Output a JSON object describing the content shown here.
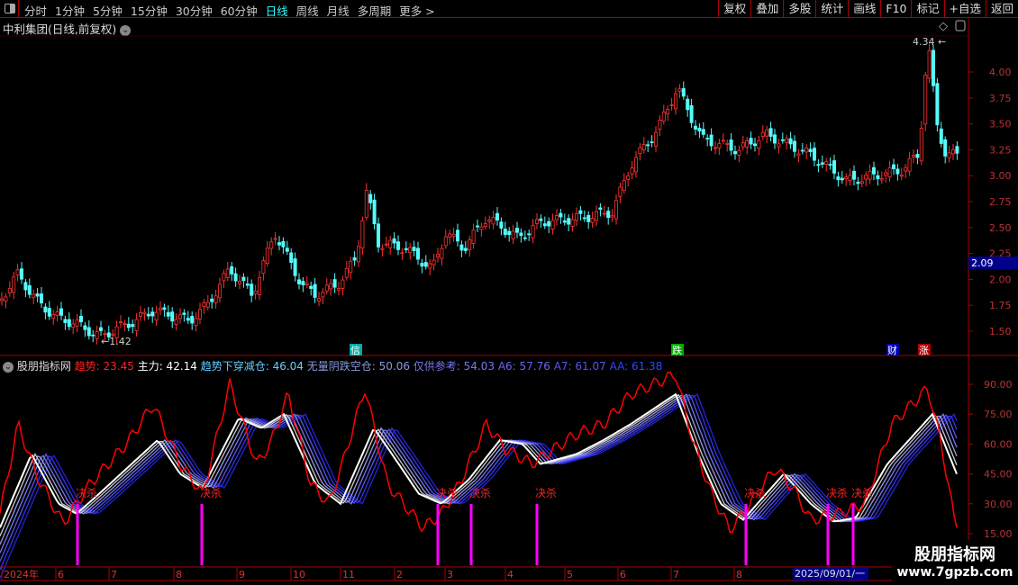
{
  "toolbar": {
    "periods": [
      "分时",
      "1分钟",
      "5分钟",
      "15分钟",
      "30分钟",
      "60分钟",
      "日线",
      "周线",
      "月线",
      "多周期",
      "更多 >"
    ],
    "active": "日线",
    "buttons": [
      "复权",
      "叠加",
      "多股",
      "统计",
      "画线",
      "F10",
      "标记",
      "+自选",
      "返回"
    ]
  },
  "title": "中利集团(日线,前复权)",
  "price_axis": [
    "4.00",
    "3.75",
    "3.50",
    "3.25",
    "3.00",
    "2.75",
    "2.50",
    "2.25",
    "2.00",
    "1.75",
    "1.50"
  ],
  "current_price": "2.09",
  "high_label": "4.34",
  "low_label": "1.42",
  "event_tags": {
    "t1": "信",
    "t2": "跌",
    "t3": "财",
    "t4": "涨"
  },
  "indicator": {
    "name": "股朋指标网",
    "items": [
      {
        "label": "趋势: 23.45",
        "color": "#ff2020"
      },
      {
        "label": "主力: 42.14",
        "color": "#ffffff"
      },
      {
        "label": "趋势下穿减仓: 46.04",
        "color": "#66ccff"
      },
      {
        "label": "无量阴跌空仓: 50.06",
        "color": "#8899dd"
      },
      {
        "label": "仅供参考: 54.03",
        "color": "#7777ee"
      },
      {
        "label": "A6: 57.76",
        "color": "#6666ee"
      },
      {
        "label": "A7: 61.07",
        "color": "#5555ee"
      },
      {
        "label": "AA: 61.38",
        "color": "#3344ff"
      }
    ],
    "axis": [
      "90.00",
      "75.00",
      "60.00",
      "45.00",
      "30.00",
      "15.00"
    ],
    "signal": "决杀"
  },
  "time_axis": [
    [
      "2024年",
      2
    ],
    [
      "6",
      62
    ],
    [
      "7",
      121
    ],
    [
      "8",
      193
    ],
    [
      "9",
      263
    ],
    [
      "10",
      323
    ],
    [
      "11",
      378
    ],
    [
      "2",
      438
    ],
    [
      "3",
      494
    ],
    [
      "4",
      561
    ],
    [
      "5",
      627
    ],
    [
      "6",
      686
    ],
    [
      "7",
      745
    ],
    [
      "8",
      815
    ]
  ],
  "selected_date": "2025/09/01/一",
  "watermark": {
    "line1": "股朋指标网",
    "line2": "www.7gpzb.com"
  },
  "price_path": [
    [
      0,
      1.8
    ],
    [
      20,
      2.05
    ],
    [
      40,
      1.8
    ],
    [
      60,
      1.65
    ],
    [
      90,
      1.55
    ],
    [
      110,
      1.45
    ],
    [
      150,
      1.6
    ],
    [
      170,
      1.7
    ],
    [
      210,
      1.6
    ],
    [
      230,
      1.75
    ],
    [
      255,
      2.1
    ],
    [
      280,
      1.85
    ],
    [
      305,
      2.45
    ],
    [
      320,
      2.2
    ],
    [
      335,
      1.95
    ],
    [
      350,
      1.85
    ],
    [
      375,
      1.95
    ],
    [
      395,
      2.2
    ],
    [
      407,
      2.85
    ],
    [
      420,
      2.35
    ],
    [
      450,
      2.3
    ],
    [
      480,
      2.1
    ],
    [
      495,
      2.45
    ],
    [
      515,
      2.3
    ],
    [
      540,
      2.6
    ],
    [
      575,
      2.4
    ],
    [
      600,
      2.55
    ],
    [
      650,
      2.6
    ],
    [
      680,
      2.65
    ],
    [
      700,
      3.1
    ],
    [
      730,
      3.45
    ],
    [
      752,
      3.85
    ],
    [
      765,
      3.6
    ],
    [
      780,
      3.35
    ],
    [
      820,
      3.25
    ],
    [
      850,
      3.4
    ],
    [
      900,
      3.2
    ],
    [
      940,
      2.95
    ],
    [
      970,
      3.0
    ],
    [
      1000,
      3.05
    ],
    [
      1020,
      3.2
    ],
    [
      1030,
      4.3
    ],
    [
      1040,
      3.5
    ],
    [
      1050,
      3.2
    ],
    [
      1062,
      3.2
    ]
  ],
  "trend_path": [
    [
      0,
      25
    ],
    [
      20,
      70
    ],
    [
      40,
      45
    ],
    [
      70,
      20
    ],
    [
      100,
      40
    ],
    [
      140,
      60
    ],
    [
      170,
      80
    ],
    [
      200,
      50
    ],
    [
      225,
      35
    ],
    [
      255,
      90
    ],
    [
      285,
      50
    ],
    [
      300,
      60
    ],
    [
      320,
      85
    ],
    [
      345,
      40
    ],
    [
      365,
      30
    ],
    [
      380,
      50
    ],
    [
      405,
      88
    ],
    [
      430,
      40
    ],
    [
      470,
      18
    ],
    [
      490,
      25
    ],
    [
      510,
      40
    ],
    [
      540,
      70
    ],
    [
      560,
      58
    ],
    [
      590,
      50
    ],
    [
      640,
      65
    ],
    [
      670,
      70
    ],
    [
      700,
      85
    ],
    [
      750,
      95
    ],
    [
      770,
      60
    ],
    [
      790,
      35
    ],
    [
      810,
      17
    ],
    [
      830,
      28
    ],
    [
      860,
      48
    ],
    [
      880,
      38
    ],
    [
      900,
      22
    ],
    [
      930,
      25
    ],
    [
      960,
      30
    ],
    [
      990,
      70
    ],
    [
      1030,
      88
    ],
    [
      1045,
      60
    ],
    [
      1060,
      20
    ]
  ],
  "main_path": [
    [
      0,
      18
    ],
    [
      35,
      55
    ],
    [
      65,
      30
    ],
    [
      85,
      25
    ],
    [
      110,
      35
    ],
    [
      175,
      62
    ],
    [
      200,
      45
    ],
    [
      225,
      38
    ],
    [
      265,
      73
    ],
    [
      290,
      68
    ],
    [
      315,
      75
    ],
    [
      350,
      40
    ],
    [
      378,
      30
    ],
    [
      415,
      68
    ],
    [
      435,
      55
    ],
    [
      465,
      35
    ],
    [
      490,
      30
    ],
    [
      520,
      42
    ],
    [
      555,
      62
    ],
    [
      580,
      60
    ],
    [
      600,
      50
    ],
    [
      640,
      55
    ],
    [
      670,
      62
    ],
    [
      700,
      70
    ],
    [
      750,
      85
    ],
    [
      775,
      55
    ],
    [
      800,
      30
    ],
    [
      825,
      22
    ],
    [
      870,
      45
    ],
    [
      900,
      30
    ],
    [
      925,
      21
    ],
    [
      950,
      23
    ],
    [
      985,
      50
    ],
    [
      1035,
      75
    ],
    [
      1062,
      45
    ]
  ],
  "signals": [
    86,
    224,
    486,
    523,
    596,
    828,
    919,
    947
  ]
}
